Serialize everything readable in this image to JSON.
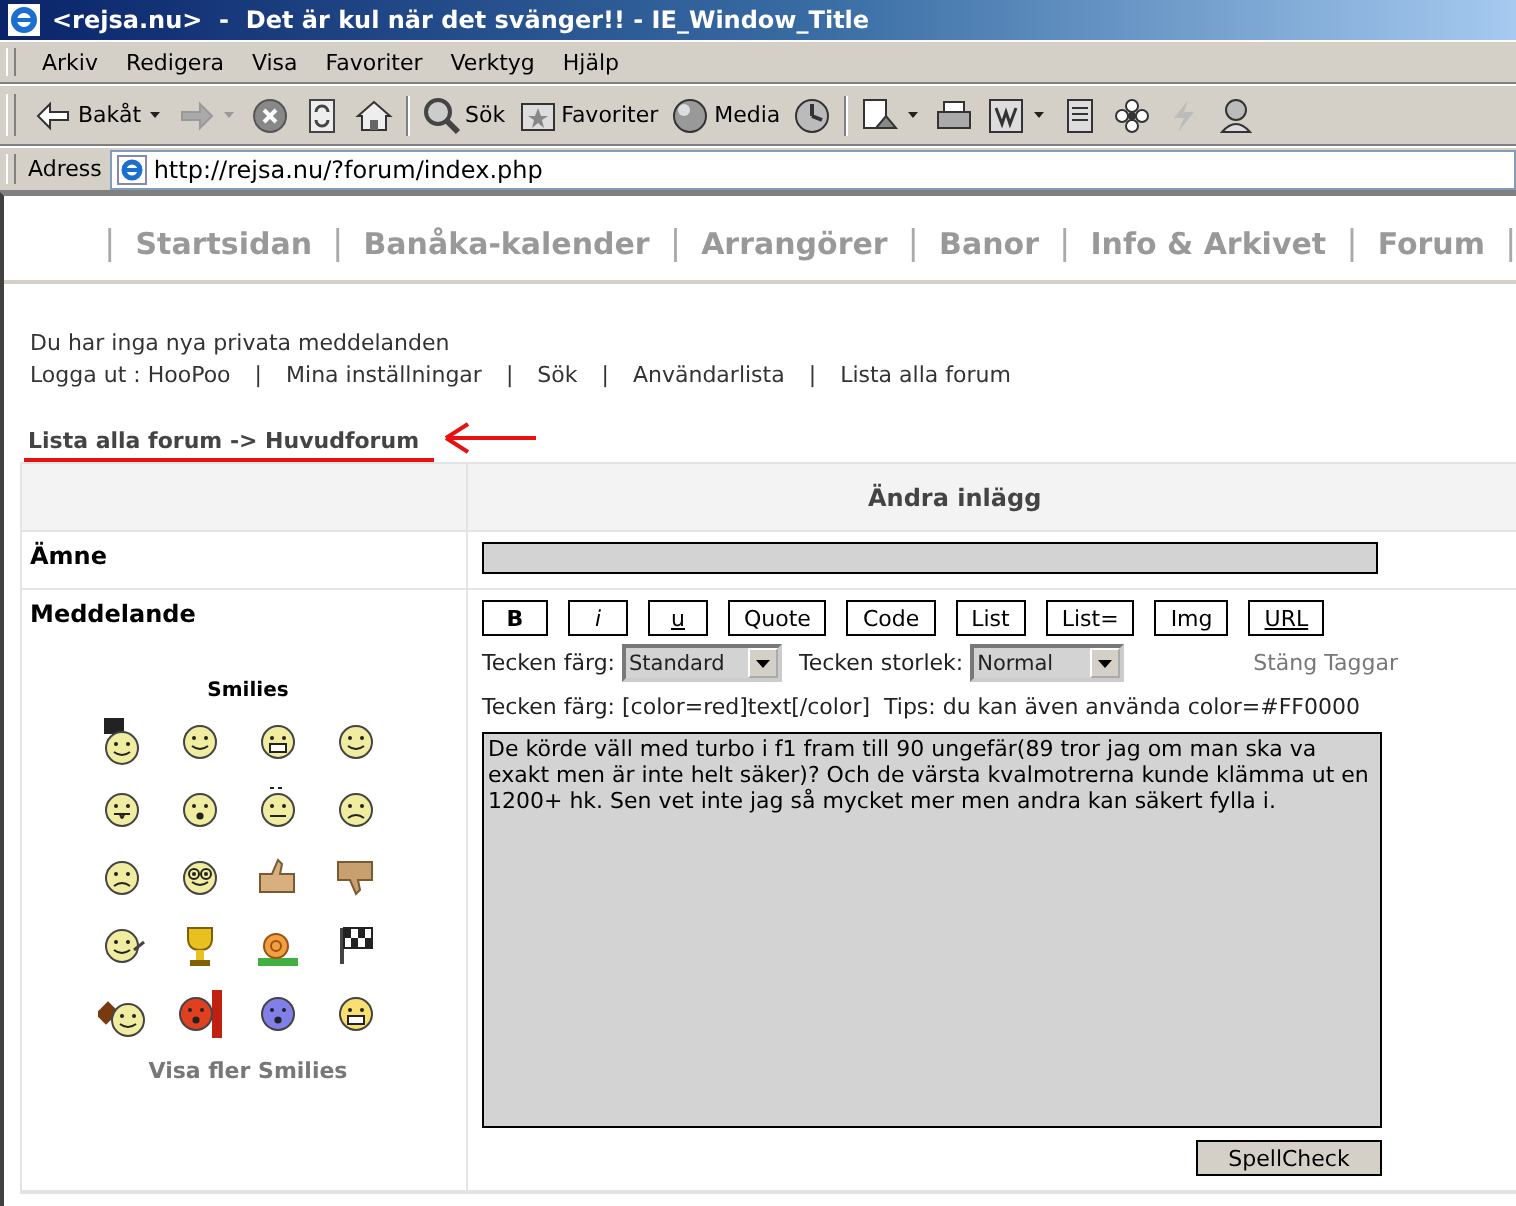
{
  "window": {
    "title": "<rejsa.nu>  -  Det är kul när det svänger!! - IE_Window_Title"
  },
  "menu": [
    "Arkiv",
    "Redigera",
    "Visa",
    "Favoriter",
    "Verktyg",
    "Hjälp"
  ],
  "toolbar": [
    {
      "kind": "back",
      "label": "Bakåt"
    },
    {
      "kind": "forward"
    },
    {
      "kind": "stop"
    },
    {
      "kind": "refresh"
    },
    {
      "kind": "home"
    },
    {
      "kind": "search",
      "label": "Sök"
    },
    {
      "kind": "favorites",
      "label": "Favoriter"
    },
    {
      "kind": "media",
      "label": "Media"
    },
    {
      "kind": "history"
    },
    {
      "kind": "mail"
    },
    {
      "kind": "print"
    },
    {
      "kind": "edit"
    },
    {
      "kind": "page"
    },
    {
      "kind": "flower"
    },
    {
      "kind": "lightning"
    },
    {
      "kind": "person"
    }
  ],
  "address": {
    "label": "Adress",
    "url": "http://rejsa.nu/?forum/index.php"
  },
  "nav_separator": "|",
  "link_separator": "|",
  "nav": [
    "Startsidan",
    "Banåka-kalender",
    "Arrangörer",
    "Banor",
    "Info & Arkivet",
    "Forum"
  ],
  "pm_notice": "Du har inga nya privata meddelanden",
  "user_links": [
    "Logga ut : HooPoo",
    "Mina inställningar",
    "Sök",
    "Användarlista",
    "Lista alla forum"
  ],
  "breadcrumb": "Lista alla forum -> Huvudforum",
  "form": {
    "title": "Ändra inlägg",
    "subject_label": "Ämne",
    "message_label": "Meddelande",
    "smilies_title": "Smilies",
    "more_smilies": "Visa fler Smilies",
    "tag_buttons": [
      {
        "label": "B",
        "kind": "bold"
      },
      {
        "label": "i",
        "kind": "italic"
      },
      {
        "label": "u",
        "kind": "underline"
      },
      {
        "label": "Quote",
        "kind": "plain"
      },
      {
        "label": "Code",
        "kind": "plain"
      },
      {
        "label": "List",
        "kind": "plain"
      },
      {
        "label": "List=",
        "kind": "plain"
      },
      {
        "label": "Img",
        "kind": "plain"
      },
      {
        "label": "URL",
        "kind": "underline"
      }
    ],
    "color_label": "Tecken färg:",
    "color_value": "Standard",
    "size_label": "Tecken storlek:",
    "size_value": "Normal",
    "close_tags": "Stäng Taggar",
    "hint": "Tecken färg: [color=red]text[/color]  Tips: du kan även använda color=#FF0000",
    "message": "De körde väll med turbo i f1 fram till 90 ungefär(89 tror jag om man ska va exakt men är inte helt säker)? Och de värsta kvalmotrerna kunde klämma ut en 1200+ hk. Sen vet inte jag så mycket mer men andra kan säkert fylla i.",
    "spellcheck": "SpellCheck"
  }
}
